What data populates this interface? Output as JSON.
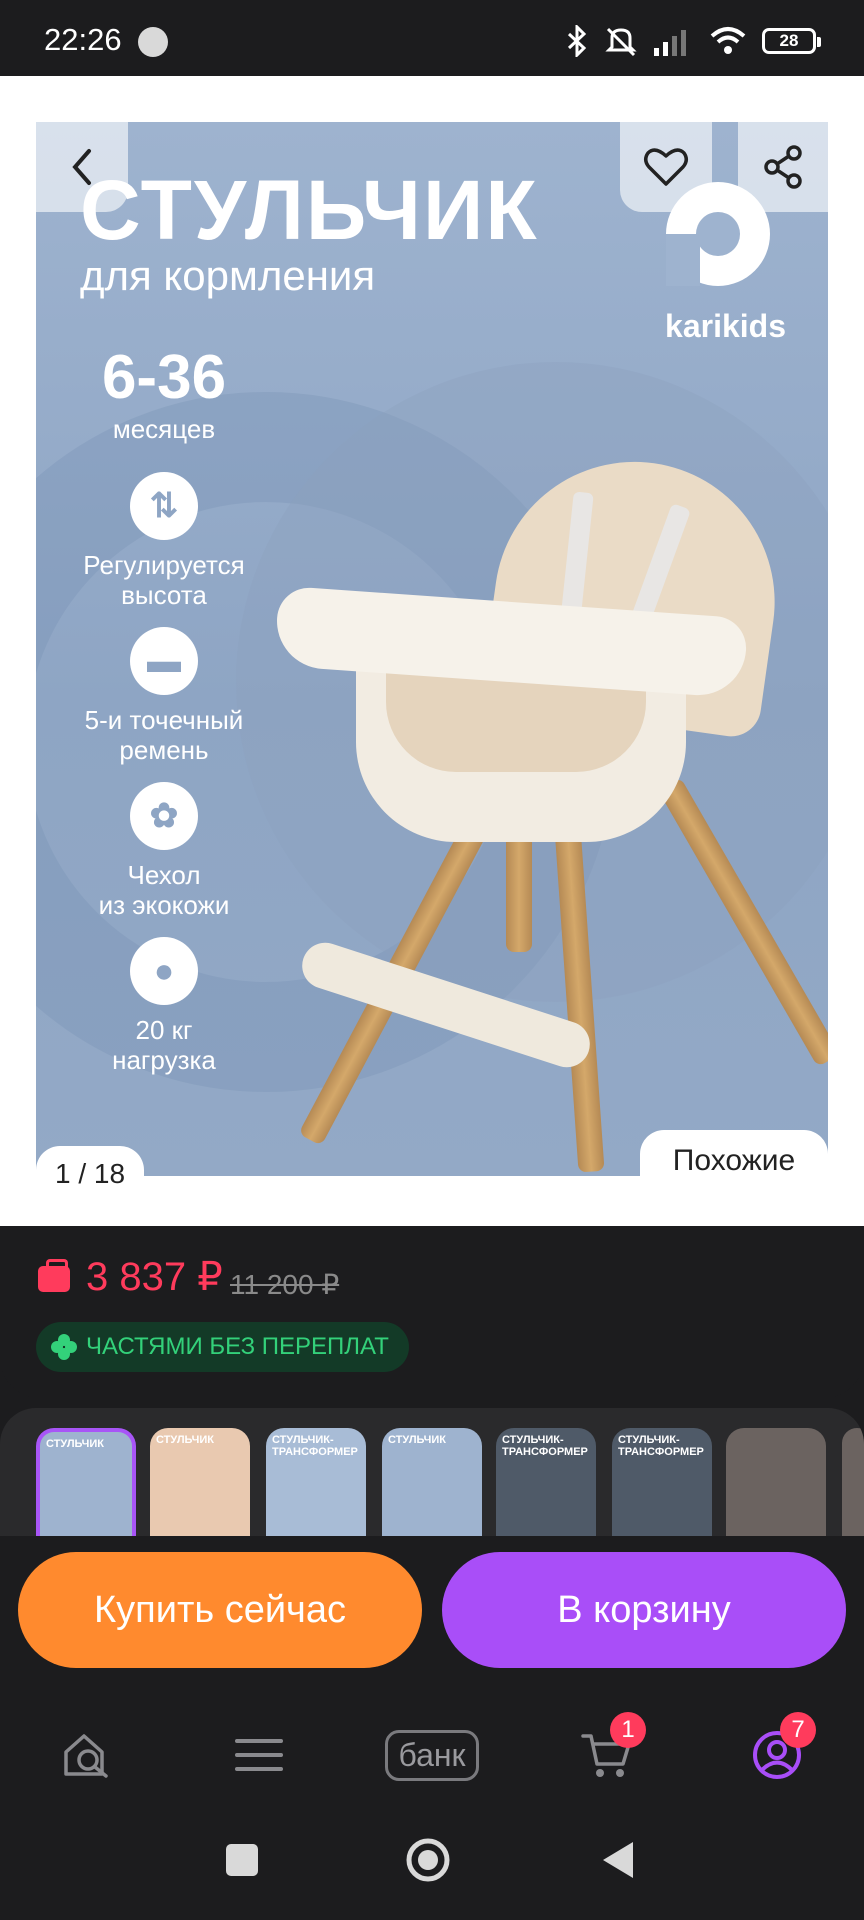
{
  "status_bar": {
    "time": "22:26",
    "battery": "28"
  },
  "product_image": {
    "title": "СТУЛЬЧИК",
    "subtitle": "для кормления",
    "brand": "karikids",
    "age_range": "6-36",
    "age_unit": "месяцев",
    "features": [
      {
        "icon": "height-adjust-icon",
        "line1": "Регулируется",
        "line2": "высота"
      },
      {
        "icon": "harness-icon",
        "line1": "5-и точечный",
        "line2": "ремень"
      },
      {
        "icon": "leather-icon",
        "line1": "Чехол",
        "line2": "из экокожи"
      },
      {
        "icon": "kettlebell-icon",
        "line1": "20 кг",
        "line2": "нагрузка"
      }
    ]
  },
  "gallery": {
    "counter": "1 / 18",
    "similar_label": "Похожие"
  },
  "price": {
    "current": "3 837 ₽",
    "old": "11 200 ₽",
    "installment": "ЧАСТЯМИ БЕЗ ПЕРЕПЛАТ"
  },
  "thumbnails": [
    {
      "title": "СТУЛЬЧИК",
      "bg": "#9eb3cf",
      "active": true
    },
    {
      "title": "СТУЛЬЧИК",
      "bg": "#e9c9b0",
      "active": false
    },
    {
      "title": "СТУЛЬЧИК-ТРАНСФОРМЕР",
      "bg": "#a8bcd6",
      "active": false
    },
    {
      "title": "СТУЛЬЧИК",
      "bg": "#9eb3cf",
      "active": false
    },
    {
      "title": "СТУЛЬЧИК-ТРАНСФОРМЕР",
      "bg": "#4f5a68",
      "active": false
    },
    {
      "title": "СТУЛЬЧИК-ТРАНСФОРМЕР",
      "bg": "#4f5a68",
      "active": false
    },
    {
      "title": "",
      "bg": "#6b6360",
      "active": false
    }
  ],
  "actions": {
    "buy_now": "Купить сейчас",
    "add_to_cart": "В корзину"
  },
  "tab_bar": {
    "bank_label": "банк",
    "cart_badge": "1",
    "profile_badge": "7"
  },
  "colors": {
    "accent_orange": "#ff8a2e",
    "accent_purple": "#a94ef8",
    "price_red": "#ff3b5c",
    "installment_green": "#33d17a"
  }
}
